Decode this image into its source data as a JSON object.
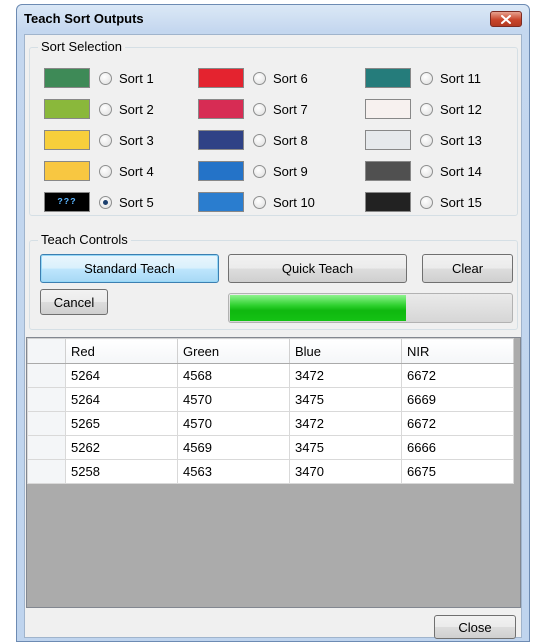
{
  "window": {
    "title": "Teach Sort Outputs",
    "close_icon": "close-icon"
  },
  "sort_selection": {
    "label": "Sort Selection",
    "selected": "Sort 5",
    "sorts": [
      {
        "label": "Sort 1",
        "color": "#3e8a57",
        "swatch_text": "",
        "selected": false
      },
      {
        "label": "Sort 2",
        "color": "#8ab83b",
        "swatch_text": "",
        "selected": false
      },
      {
        "label": "Sort 3",
        "color": "#f7cf3b",
        "swatch_text": "",
        "selected": false
      },
      {
        "label": "Sort 4",
        "color": "#f8c741",
        "swatch_text": "",
        "selected": false
      },
      {
        "label": "Sort 5",
        "color": "#000000",
        "swatch_text": "???",
        "selected": true
      },
      {
        "label": "Sort 6",
        "color": "#e4232f",
        "swatch_text": "",
        "selected": false
      },
      {
        "label": "Sort 7",
        "color": "#d72c54",
        "swatch_text": "",
        "selected": false
      },
      {
        "label": "Sort 8",
        "color": "#2f4286",
        "swatch_text": "",
        "selected": false
      },
      {
        "label": "Sort 9",
        "color": "#2473c8",
        "swatch_text": "",
        "selected": false
      },
      {
        "label": "Sort 10",
        "color": "#2a7dcf",
        "swatch_text": "",
        "selected": false
      },
      {
        "label": "Sort 11",
        "color": "#257c7b",
        "swatch_text": "",
        "selected": false
      },
      {
        "label": "Sort 12",
        "color": "#f7f1ef",
        "swatch_text": "",
        "selected": false
      },
      {
        "label": "Sort 13",
        "color": "#e6e9ec",
        "swatch_text": "",
        "selected": false
      },
      {
        "label": "Sort 14",
        "color": "#505050",
        "swatch_text": "",
        "selected": false
      },
      {
        "label": "Sort 15",
        "color": "#222222",
        "swatch_text": "",
        "selected": false
      }
    ]
  },
  "teach_controls": {
    "label": "Teach Controls",
    "standard_teach": "Standard Teach",
    "quick_teach": "Quick Teach",
    "clear": "Clear",
    "cancel": "Cancel",
    "progress_fraction": 0.63,
    "progress_color": "#1fc41f"
  },
  "table": {
    "columns": [
      "Red",
      "Green",
      "Blue",
      "NIR"
    ],
    "rows": [
      [
        "5264",
        "4568",
        "3472",
        "6672"
      ],
      [
        "5264",
        "4570",
        "3475",
        "6669"
      ],
      [
        "5265",
        "4570",
        "3472",
        "6672"
      ],
      [
        "5262",
        "4569",
        "3475",
        "6666"
      ],
      [
        "5258",
        "4563",
        "3470",
        "6675"
      ]
    ]
  },
  "footer": {
    "close": "Close"
  }
}
